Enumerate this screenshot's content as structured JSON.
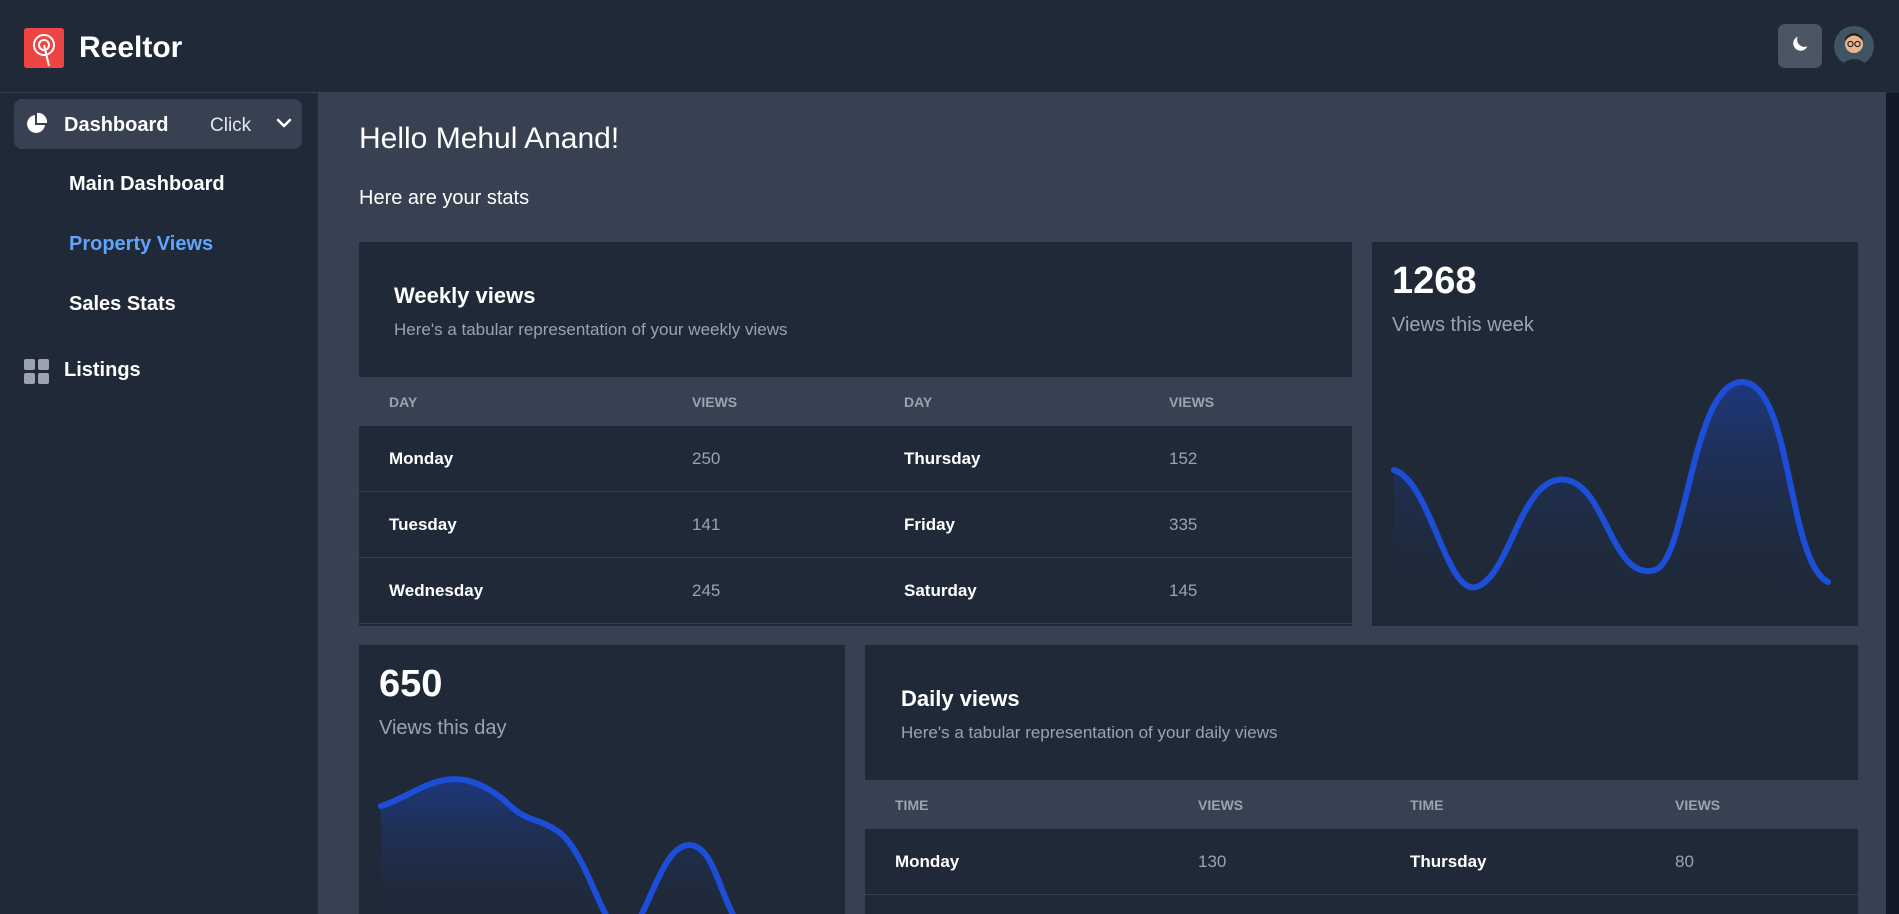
{
  "header": {
    "brand": "Reeltor",
    "theme_icon": "moon-icon",
    "avatar_icon": "user-avatar"
  },
  "sidebar": {
    "dashboard": {
      "label": "Dashboard",
      "hint": "Click",
      "icon": "pie-chart-icon"
    },
    "items": [
      {
        "label": "Main Dashboard",
        "active": false
      },
      {
        "label": "Property Views",
        "active": true
      },
      {
        "label": "Sales Stats",
        "active": false
      }
    ],
    "listings": {
      "label": "Listings",
      "icon": "grid-icon"
    }
  },
  "main": {
    "greeting": "Hello Mehul Anand!",
    "subtitle": "Here are your stats"
  },
  "weekly_table": {
    "title": "Weekly views",
    "subtitle": "Here's a tabular representation of your weekly views",
    "headers": [
      "DAY",
      "VIEWS",
      "DAY",
      "VIEWS"
    ],
    "rows": [
      [
        "Monday",
        "250",
        "Thursday",
        "152"
      ],
      [
        "Tuesday",
        "141",
        "Friday",
        "335"
      ],
      [
        "Wednesday",
        "245",
        "Saturday",
        "145"
      ]
    ]
  },
  "week_stat": {
    "value": "1268",
    "label": "Views this week"
  },
  "day_stat": {
    "value": "650",
    "label": "Views this day"
  },
  "daily_table": {
    "title": "Daily views",
    "subtitle": "Here's a tabular representation of your daily views",
    "headers": [
      "TIME",
      "VIEWS",
      "TIME",
      "VIEWS"
    ],
    "rows": [
      [
        "Monday",
        "130",
        "Thursday",
        "80"
      ]
    ]
  },
  "colors": {
    "line": "#1d4ed8",
    "accent": "#60a5fa",
    "card": "#1f2937",
    "background": "#374151"
  }
}
